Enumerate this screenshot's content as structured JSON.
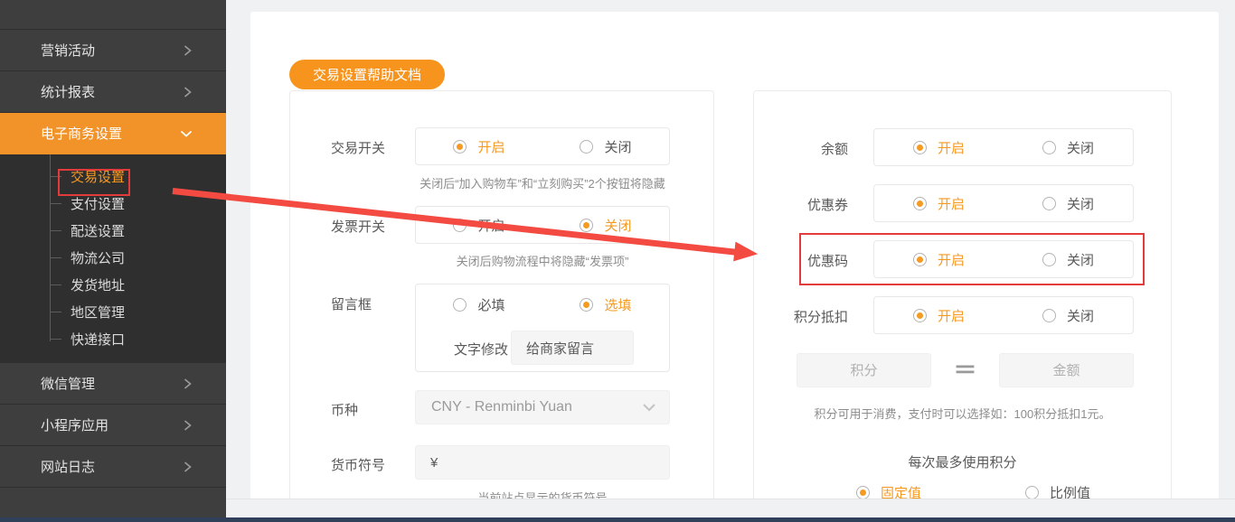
{
  "colors": {
    "accent_orange": "#f59a23",
    "sidebar_active_orange": "#f2932a",
    "button_orange": "#f7941e",
    "annotation_red": "#e23b3b",
    "sidebar_bg": "#3e3e3e"
  },
  "sidebar": {
    "top_items": [
      {
        "label": "营销活动"
      },
      {
        "label": "统计报表"
      },
      {
        "label": "电子商务设置",
        "active": true,
        "expanded": true
      }
    ],
    "submenu": [
      {
        "label": "交易设置",
        "current": true,
        "annotated": true
      },
      {
        "label": "支付设置"
      },
      {
        "label": "配送设置"
      },
      {
        "label": "物流公司"
      },
      {
        "label": "发货地址"
      },
      {
        "label": "地区管理"
      },
      {
        "label": "快递接口"
      }
    ],
    "bottom_items": [
      {
        "label": "微信管理"
      },
      {
        "label": "小程序应用"
      },
      {
        "label": "网站日志"
      }
    ]
  },
  "toolbar": {
    "help_button_label": "交易设置帮助文档"
  },
  "trade_panel": {
    "trade_switch": {
      "label": "交易开关",
      "on": "开启",
      "off": "关闭",
      "selected": "on",
      "note": "关闭后“加入购物车”和“立刻购买”2个按钮将隐藏"
    },
    "invoice_switch": {
      "label": "发票开关",
      "on": "开启",
      "off": "关闭",
      "selected": "off",
      "note": "关闭后购物流程中将隐藏“发票项”"
    },
    "message_box": {
      "label": "留言框",
      "required": "必填",
      "optional": "选填",
      "selected": "optional",
      "text_edit_label": "文字修改",
      "text_edit_value": "给商家留言"
    },
    "currency": {
      "label": "币种",
      "value": "CNY - Renminbi Yuan"
    },
    "currency_symbol": {
      "label": "货币符号",
      "value": "¥",
      "note": "当前站点显示的货币符号"
    }
  },
  "discount_panel": {
    "balance": {
      "label": "余额",
      "on": "开启",
      "off": "关闭",
      "selected": "on"
    },
    "coupon": {
      "label": "优惠券",
      "on": "开启",
      "off": "关闭",
      "selected": "on"
    },
    "coupon_code": {
      "label": "优惠码",
      "on": "开启",
      "off": "关闭",
      "selected": "on",
      "annotated": true
    },
    "points_deduction": {
      "label": "积分抵扣",
      "on": "开启",
      "off": "关闭",
      "selected": "on"
    },
    "points_rate": {
      "points_placeholder": "积分",
      "equals": "＝",
      "amount_placeholder": "金额",
      "note": "积分可用于消费，支付时可以选择如：100积分抵扣1元。"
    },
    "max_points": {
      "title": "每次最多使用积分",
      "fixed": "固定值",
      "ratio": "比例值",
      "selected": "fixed"
    }
  }
}
